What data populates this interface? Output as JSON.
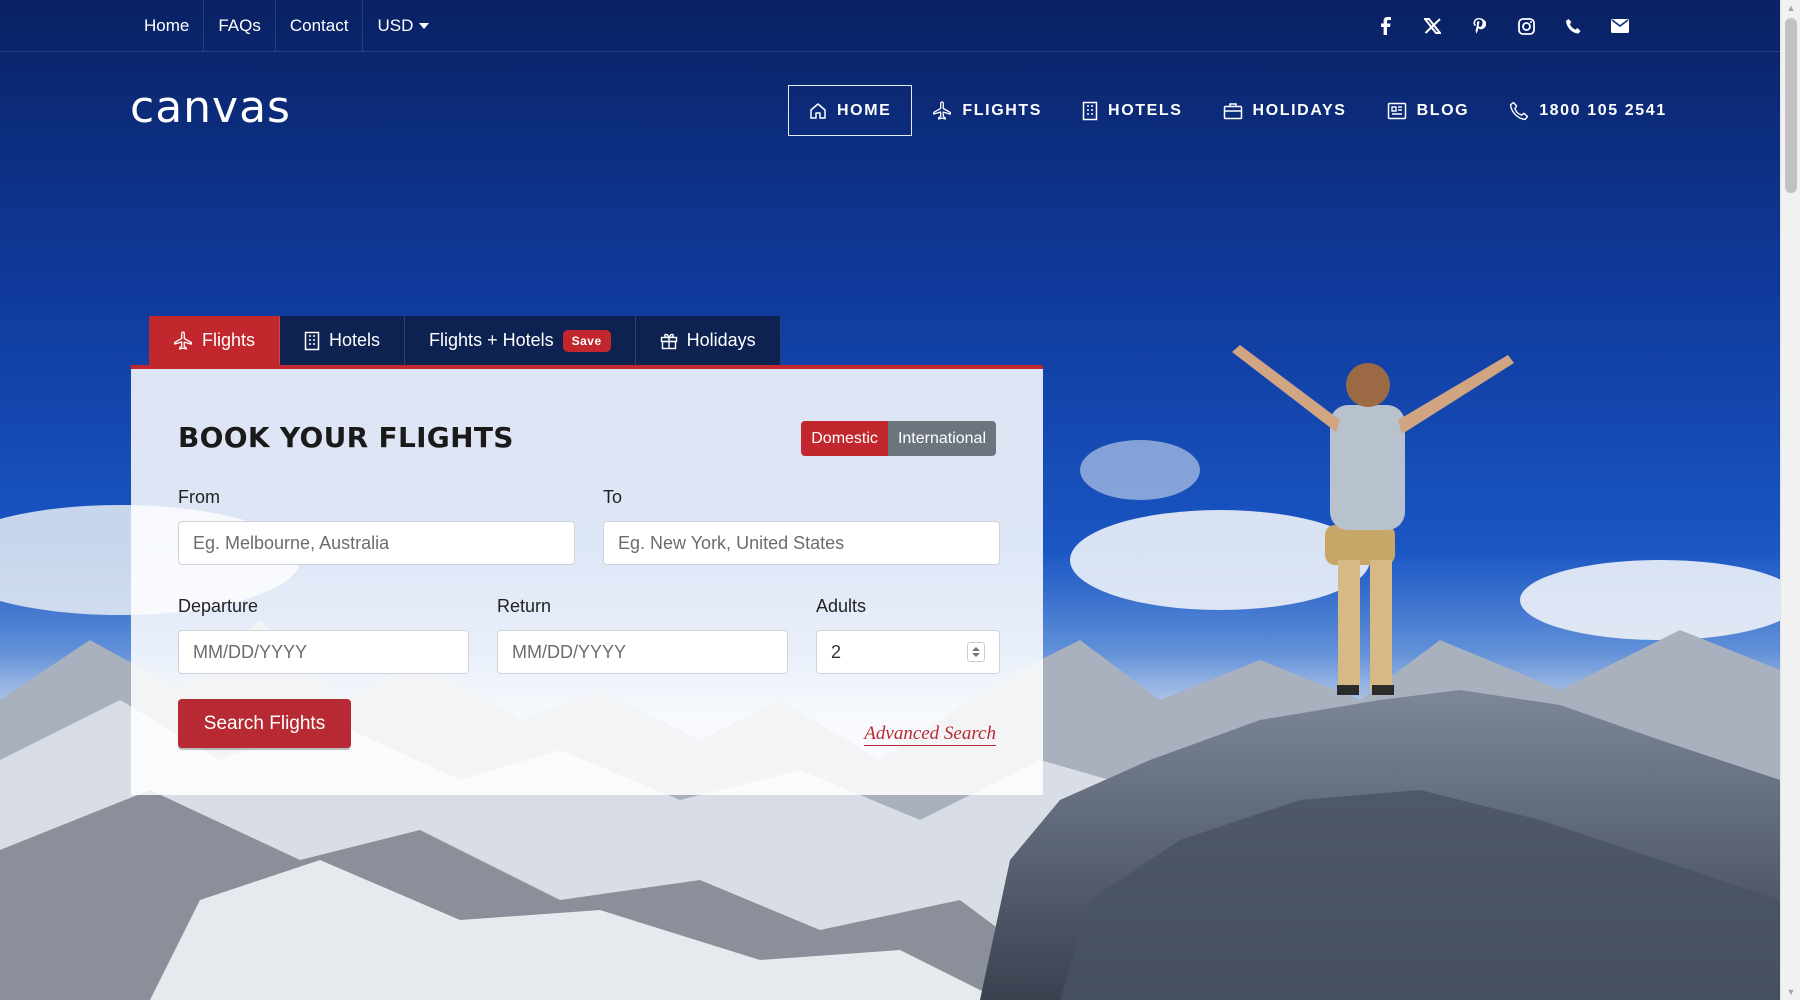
{
  "topbar": {
    "links": [
      "Home",
      "FAQs",
      "Contact",
      "USD"
    ],
    "socials": [
      "facebook-icon",
      "x-icon",
      "pinterest-icon",
      "instagram-icon",
      "phone-icon",
      "mail-icon"
    ]
  },
  "header": {
    "logo": "canvas",
    "nav": [
      {
        "label": "HOME",
        "icon": "home-icon",
        "active": true
      },
      {
        "label": "FLIGHTS",
        "icon": "plane-icon"
      },
      {
        "label": "HOTELS",
        "icon": "building-icon"
      },
      {
        "label": "HOLIDAYS",
        "icon": "suitcase-icon"
      },
      {
        "label": "BLOG",
        "icon": "newspaper-icon"
      },
      {
        "label": "1800 105 2541",
        "icon": "phone-icon"
      }
    ]
  },
  "booking": {
    "tabs": [
      {
        "label": "Flights",
        "icon": "plane-icon",
        "active": true
      },
      {
        "label": "Hotels",
        "icon": "building-icon"
      },
      {
        "label": "Flights + Hotels",
        "badge": "Save"
      },
      {
        "label": "Holidays",
        "icon": "gift-icon"
      }
    ],
    "title": "BOOK YOUR FLIGHTS",
    "toggle": {
      "domestic": "Domestic",
      "international": "International",
      "selected": "Domestic"
    },
    "from": {
      "label": "From",
      "placeholder": "Eg. Melbourne, Australia"
    },
    "to": {
      "label": "To",
      "placeholder": "Eg. New York, United States"
    },
    "departure": {
      "label": "Departure",
      "placeholder": "MM/DD/YYYY"
    },
    "return": {
      "label": "Return",
      "placeholder": "MM/DD/YYYY"
    },
    "adults": {
      "label": "Adults",
      "value": "2"
    },
    "search_button": "Search Flights",
    "advanced_link": "Advanced Search"
  },
  "colors": {
    "accent": "#c1272d",
    "tab_dark": "#0d2250",
    "sky": "#1550bf"
  }
}
